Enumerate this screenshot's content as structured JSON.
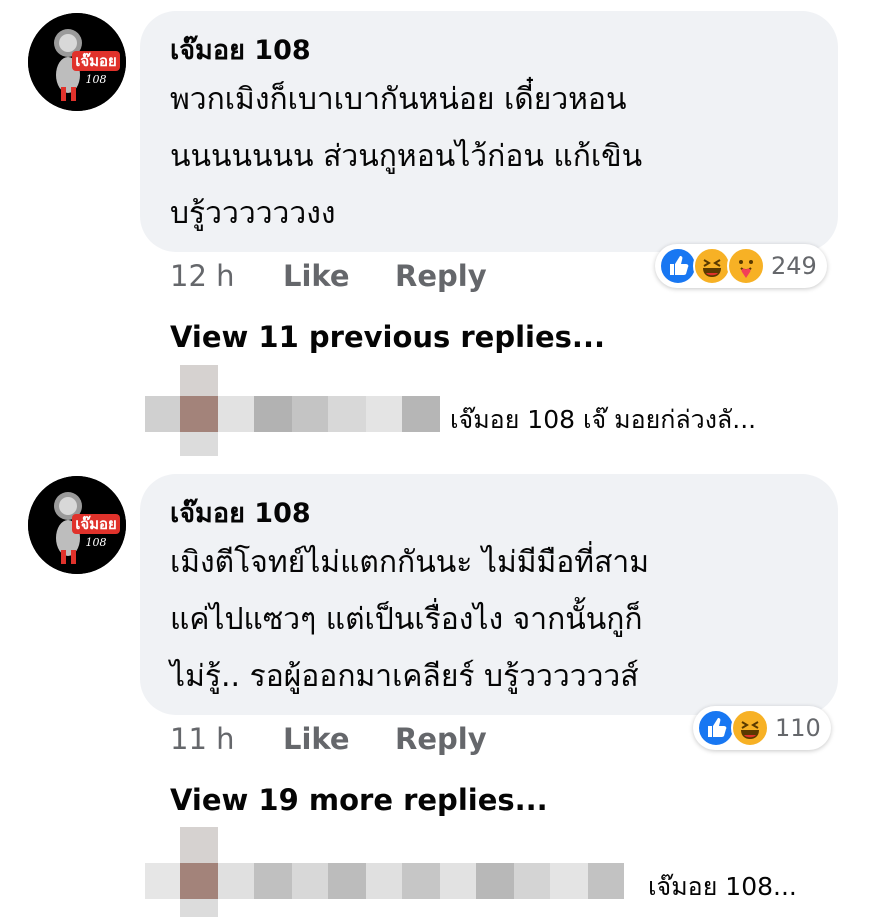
{
  "comments": [
    {
      "author": "เจ๊มอย 108",
      "avatar_text": "เจ๊มอย",
      "avatar_sub": "108",
      "text": "พวกเมิงก็เบาเบากันหน่อย เดี๋ยวหอน\nนนนนนนน ส่วนกูหอนไว้ก่อน แก้เขิน\nบรู้ววววววงง",
      "time": "12 h",
      "like_label": "Like",
      "reply_label": "Reply",
      "reaction_count": "249",
      "reactions": [
        "like-icon",
        "haha-icon",
        "care-icon"
      ],
      "view_replies": "View 11 previous replies...",
      "reply_preview": "เจ๊มอย 108 เจ๊ มอยก่ล่วงลั..."
    },
    {
      "author": "เจ๊มอย 108",
      "avatar_text": "เจ๊มอย",
      "avatar_sub": "108",
      "text": "เมิงตีโจทย์ไม่แตกกันนะ ไม่มีมือที่สาม\nแค่ไปแซวๆ แต่เป็นเรื่องไง จากนั้นกูก็\nไม่รู้.. รอผู้ออกมาเคลียร์ บรู้ววววววส์",
      "time": "11 h",
      "like_label": "Like",
      "reply_label": "Reply",
      "reaction_count": "110",
      "reactions": [
        "like-icon",
        "haha-icon"
      ],
      "view_replies": "View 19 more replies...",
      "reply_preview": "เจ๊มอย 108..."
    }
  ],
  "colors": {
    "bubble": "#f0f2f5",
    "muted": "#65676b",
    "like_blue": "#1877f2",
    "haha_yellow": "#f7b125",
    "avatar_red": "#e0322b"
  }
}
